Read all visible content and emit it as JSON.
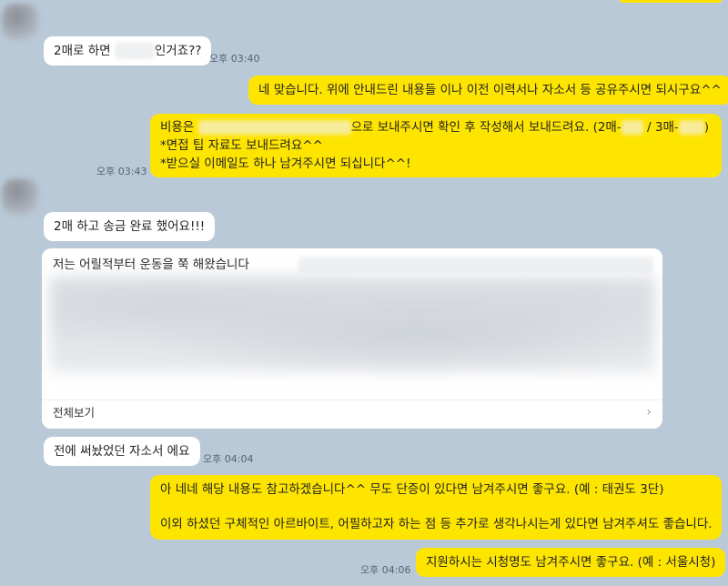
{
  "colors": {
    "background": "#b9c9d8",
    "incoming": "#ffffff",
    "outgoing": "#fee500"
  },
  "messages": {
    "m1": {
      "pre": "2매로 하면 ",
      "post": "인거죠??",
      "time": "오후 03:40"
    },
    "m2": {
      "text": "네 맞습니다. 위에 안내드린 내용들 이나 이전 이력서나 자소서 등 공유주시면 되시구요^^"
    },
    "m3": {
      "line1_pre": "비용은 ",
      "line1_mid": "으로 보내주시면 확인 후 작성해서 보내드려요. (2매-",
      "line1_slash": " / 3매-",
      "line1_end": ")",
      "line2": "*면접 팁 자료도 보내드려요^^",
      "line3": "*받으실 이메일도 하나 남겨주시면 되십니다^^!",
      "time": "오후 03:43"
    },
    "m4": {
      "text": "2매 하고 송금 완료 했어요!!!"
    },
    "m5": {
      "preview_text": "저는 어릴적부터 운동을 쭉 해왔습니다",
      "view_all": "전체보기"
    },
    "m6": {
      "text": "전에 써놨었던 자소서 에요",
      "time": "오후 04:04"
    },
    "m7": {
      "line1": "아 네네 해당 내용도 참고하겠습니다^^ 무도 단증이 있다면 남겨주시면 좋구요. (예 : 태권도 3단)",
      "line2": "이외 하셨던 구체적인 아르바이트, 어필하고자 하는 점 등 추가로 생각나시는게 있다면 남겨주셔도 좋습니다."
    },
    "m8": {
      "text": "지원하시는 시청명도 남겨주시면 좋구요. (예 : 서울시청)",
      "time": "오후 04:06"
    }
  }
}
